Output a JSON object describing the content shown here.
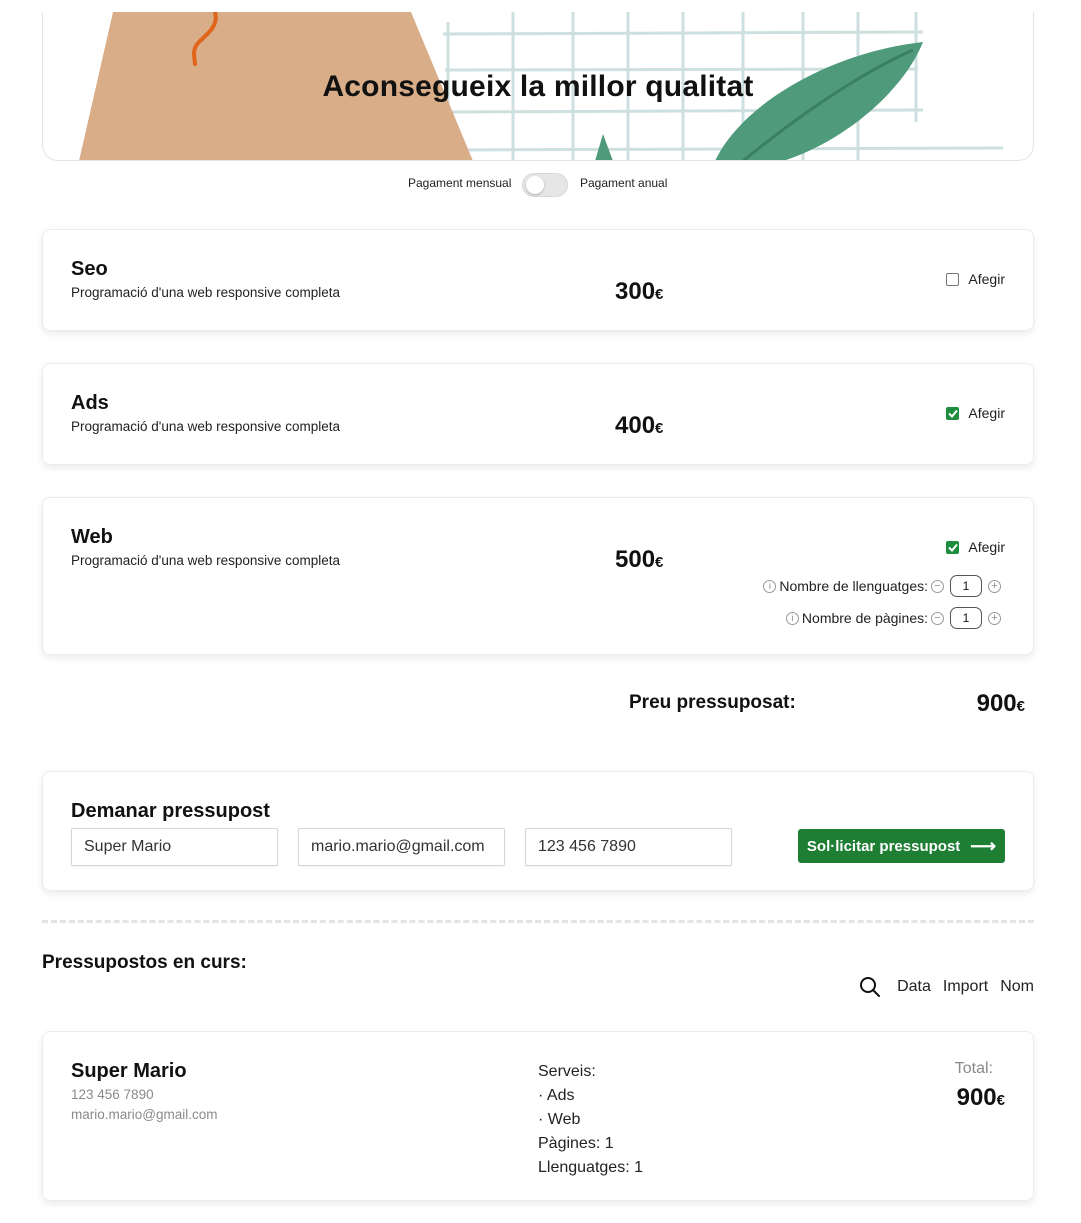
{
  "hero": {
    "title": "Aconsegueix la millor qualitat"
  },
  "billing": {
    "monthly_label": "Pagament mensual",
    "annual_label": "Pagament anual"
  },
  "services": [
    {
      "name": "Seo",
      "description": "Programació d'una web responsive completa",
      "price": "300",
      "currency": "€",
      "add_label": "Afegir",
      "checked": false
    },
    {
      "name": "Ads",
      "description": "Programació d'una web responsive completa",
      "price": "400",
      "currency": "€",
      "add_label": "Afegir",
      "checked": true
    },
    {
      "name": "Web",
      "description": "Programació d'una web responsive completa",
      "price": "500",
      "currency": "€",
      "add_label": "Afegir",
      "checked": true,
      "options": [
        {
          "label": "Nombre de llenguatges:",
          "value": "1"
        },
        {
          "label": "Nombre de pàgines:",
          "value": "1"
        }
      ]
    }
  ],
  "budget_total": {
    "label": "Preu pressuposat:",
    "value": "900",
    "currency": "€"
  },
  "request_form": {
    "title": "Demanar pressupost",
    "name_value": "Super Mario",
    "email_value": "mario.mario@gmail.com",
    "phone_value": "123 456 7890",
    "submit_label": "Sol·licitar  pressupost",
    "submit_arrow": "⟶"
  },
  "budgets_list": {
    "title": "Pressupostos en curs:",
    "sort_options": [
      "Data",
      "Import",
      "Nom"
    ],
    "items": [
      {
        "name": "Super Mario",
        "phone": "123 456 7890",
        "email": "mario.mario@gmail.com",
        "services_label": "Serveis:",
        "services": [
          "· Ads",
          "· Web"
        ],
        "pages_label": "Pàgines: 1",
        "languages_label": "Llenguatges: 1",
        "total_label": "Total:",
        "total_value": "900",
        "currency": "€"
      }
    ]
  },
  "colors": {
    "accent_green": "#1e7e34",
    "checkbox_green": "#1e8e3e",
    "hero_sand": "#d9ad88",
    "hero_leaf": "#4e9a7b",
    "hero_grid": "#c7dadb"
  },
  "icons": [
    "info-icon",
    "minus-circle-icon",
    "plus-circle-icon",
    "search-icon",
    "arrow-right-icon",
    "checkmark-icon"
  ]
}
